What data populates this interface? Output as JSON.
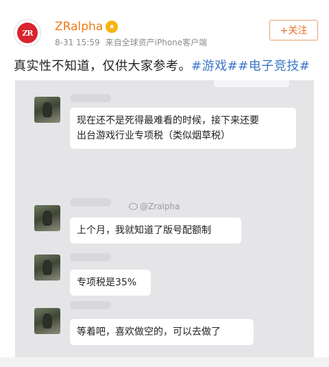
{
  "post": {
    "author": "ZRalpha",
    "avatar_text": "ZR",
    "date": "8-31 15:59",
    "source": "来自全球资产iPhone客户端",
    "follow_label": "+关注",
    "text_plain": "真实性不知道，仅供大家参考。",
    "tags": [
      "#游戏#",
      "#电子竞技#"
    ]
  },
  "screenshot": {
    "watermark": "@Zralpha",
    "messages": [
      {
        "lines": [
          "现在还不是死得最难看的时候，接下来还要",
          "出台游戏行业专项税（类似烟草税）"
        ]
      },
      {
        "lines": [
          "上个月，我就知道了版号配额制"
        ]
      },
      {
        "lines": [
          "专项税是35%"
        ]
      },
      {
        "lines": [
          "等着吧，喜欢做空的，可以去做了"
        ]
      }
    ]
  }
}
